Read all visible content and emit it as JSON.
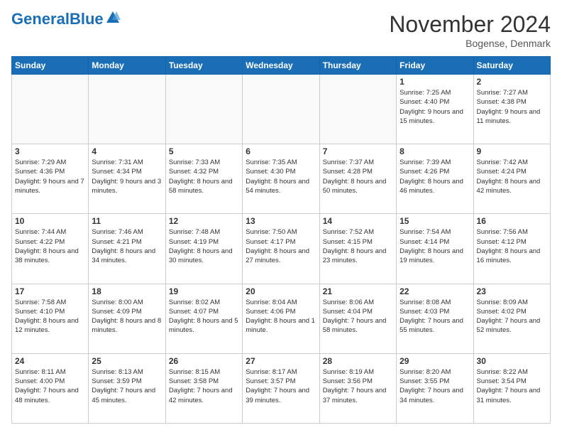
{
  "header": {
    "logo_general": "General",
    "logo_blue": "Blue",
    "month_title": "November 2024",
    "location": "Bogense, Denmark"
  },
  "days_of_week": [
    "Sunday",
    "Monday",
    "Tuesday",
    "Wednesday",
    "Thursday",
    "Friday",
    "Saturday"
  ],
  "weeks": [
    [
      {
        "day": "",
        "info": ""
      },
      {
        "day": "",
        "info": ""
      },
      {
        "day": "",
        "info": ""
      },
      {
        "day": "",
        "info": ""
      },
      {
        "day": "",
        "info": ""
      },
      {
        "day": "1",
        "info": "Sunrise: 7:25 AM\nSunset: 4:40 PM\nDaylight: 9 hours and 15 minutes."
      },
      {
        "day": "2",
        "info": "Sunrise: 7:27 AM\nSunset: 4:38 PM\nDaylight: 9 hours and 11 minutes."
      }
    ],
    [
      {
        "day": "3",
        "info": "Sunrise: 7:29 AM\nSunset: 4:36 PM\nDaylight: 9 hours and 7 minutes."
      },
      {
        "day": "4",
        "info": "Sunrise: 7:31 AM\nSunset: 4:34 PM\nDaylight: 9 hours and 3 minutes."
      },
      {
        "day": "5",
        "info": "Sunrise: 7:33 AM\nSunset: 4:32 PM\nDaylight: 8 hours and 58 minutes."
      },
      {
        "day": "6",
        "info": "Sunrise: 7:35 AM\nSunset: 4:30 PM\nDaylight: 8 hours and 54 minutes."
      },
      {
        "day": "7",
        "info": "Sunrise: 7:37 AM\nSunset: 4:28 PM\nDaylight: 8 hours and 50 minutes."
      },
      {
        "day": "8",
        "info": "Sunrise: 7:39 AM\nSunset: 4:26 PM\nDaylight: 8 hours and 46 minutes."
      },
      {
        "day": "9",
        "info": "Sunrise: 7:42 AM\nSunset: 4:24 PM\nDaylight: 8 hours and 42 minutes."
      }
    ],
    [
      {
        "day": "10",
        "info": "Sunrise: 7:44 AM\nSunset: 4:22 PM\nDaylight: 8 hours and 38 minutes."
      },
      {
        "day": "11",
        "info": "Sunrise: 7:46 AM\nSunset: 4:21 PM\nDaylight: 8 hours and 34 minutes."
      },
      {
        "day": "12",
        "info": "Sunrise: 7:48 AM\nSunset: 4:19 PM\nDaylight: 8 hours and 30 minutes."
      },
      {
        "day": "13",
        "info": "Sunrise: 7:50 AM\nSunset: 4:17 PM\nDaylight: 8 hours and 27 minutes."
      },
      {
        "day": "14",
        "info": "Sunrise: 7:52 AM\nSunset: 4:15 PM\nDaylight: 8 hours and 23 minutes."
      },
      {
        "day": "15",
        "info": "Sunrise: 7:54 AM\nSunset: 4:14 PM\nDaylight: 8 hours and 19 minutes."
      },
      {
        "day": "16",
        "info": "Sunrise: 7:56 AM\nSunset: 4:12 PM\nDaylight: 8 hours and 16 minutes."
      }
    ],
    [
      {
        "day": "17",
        "info": "Sunrise: 7:58 AM\nSunset: 4:10 PM\nDaylight: 8 hours and 12 minutes."
      },
      {
        "day": "18",
        "info": "Sunrise: 8:00 AM\nSunset: 4:09 PM\nDaylight: 8 hours and 8 minutes."
      },
      {
        "day": "19",
        "info": "Sunrise: 8:02 AM\nSunset: 4:07 PM\nDaylight: 8 hours and 5 minutes."
      },
      {
        "day": "20",
        "info": "Sunrise: 8:04 AM\nSunset: 4:06 PM\nDaylight: 8 hours and 1 minute."
      },
      {
        "day": "21",
        "info": "Sunrise: 8:06 AM\nSunset: 4:04 PM\nDaylight: 7 hours and 58 minutes."
      },
      {
        "day": "22",
        "info": "Sunrise: 8:08 AM\nSunset: 4:03 PM\nDaylight: 7 hours and 55 minutes."
      },
      {
        "day": "23",
        "info": "Sunrise: 8:09 AM\nSunset: 4:02 PM\nDaylight: 7 hours and 52 minutes."
      }
    ],
    [
      {
        "day": "24",
        "info": "Sunrise: 8:11 AM\nSunset: 4:00 PM\nDaylight: 7 hours and 48 minutes."
      },
      {
        "day": "25",
        "info": "Sunrise: 8:13 AM\nSunset: 3:59 PM\nDaylight: 7 hours and 45 minutes."
      },
      {
        "day": "26",
        "info": "Sunrise: 8:15 AM\nSunset: 3:58 PM\nDaylight: 7 hours and 42 minutes."
      },
      {
        "day": "27",
        "info": "Sunrise: 8:17 AM\nSunset: 3:57 PM\nDaylight: 7 hours and 39 minutes."
      },
      {
        "day": "28",
        "info": "Sunrise: 8:19 AM\nSunset: 3:56 PM\nDaylight: 7 hours and 37 minutes."
      },
      {
        "day": "29",
        "info": "Sunrise: 8:20 AM\nSunset: 3:55 PM\nDaylight: 7 hours and 34 minutes."
      },
      {
        "day": "30",
        "info": "Sunrise: 8:22 AM\nSunset: 3:54 PM\nDaylight: 7 hours and 31 minutes."
      }
    ]
  ]
}
